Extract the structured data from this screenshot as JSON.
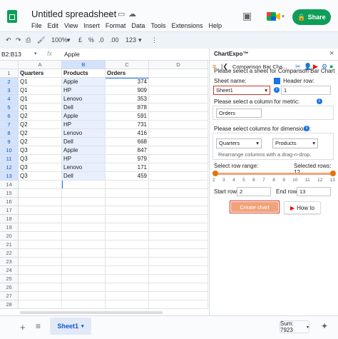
{
  "app": {
    "title": "Untitled spreadsheet",
    "menu": [
      "File",
      "Edit",
      "View",
      "Insert",
      "Format",
      "Data",
      "Tools",
      "Extensions",
      "Help"
    ],
    "share_label": "Share"
  },
  "toolbar": {
    "zoom": "100%",
    "currency": "£",
    "percent": "%",
    "dec_decrease": ".0",
    "dec_increase": ".00",
    "number_format": "123"
  },
  "formula_bar": {
    "name_box": "B2:B13",
    "value": "Apple"
  },
  "grid": {
    "columns": [
      "A",
      "B",
      "C",
      "D"
    ],
    "rows": [
      "1",
      "2",
      "3",
      "4",
      "5",
      "6",
      "7",
      "8",
      "9",
      "10",
      "11",
      "12",
      "13",
      "14",
      "15",
      "16",
      "17",
      "18",
      "19",
      "20",
      "21",
      "22",
      "23",
      "24",
      "25",
      "26",
      "27",
      "28"
    ],
    "headers": [
      "Quarters",
      "Products",
      "Orders"
    ],
    "data": [
      [
        "Q1",
        "Apple",
        "374"
      ],
      [
        "Q1",
        "HP",
        "909"
      ],
      [
        "Q1",
        "Lenovo",
        "353"
      ],
      [
        "Q1",
        "Dell",
        "878"
      ],
      [
        "Q2",
        "Apple",
        "591"
      ],
      [
        "Q2",
        "HP",
        "731"
      ],
      [
        "Q2",
        "Lenovo",
        "416"
      ],
      [
        "Q2",
        "Dell",
        "668"
      ],
      [
        "Q3",
        "Apple",
        "847"
      ],
      [
        "Q3",
        "HP",
        "979"
      ],
      [
        "Q3",
        "Lenovo",
        "171"
      ],
      [
        "Q3",
        "Dell",
        "459"
      ]
    ]
  },
  "sheet_tabs": {
    "active": "Sheet1",
    "sum": "Sum: 7923"
  },
  "panel": {
    "title": "ChartExpo™",
    "plugin_name": "Comparison Bar Cha...",
    "select_sheet_label": "Please select a sheet for Comparison Bar Chart",
    "sheet_name_label": "Sheet name:",
    "header_row_label": "Header row:",
    "sheet_value": "Sheet1",
    "header_row_value": "1",
    "metric_label": "Please select a column for metric:",
    "metric_value": "Orders",
    "dimensions_label": "Please select columns for dimensions:",
    "dimension1": "Quarters",
    "dimension2": "Products",
    "rearrange_hint": "Rearrange columns with a drag-n-drop.",
    "row_range_label": "Select row range:",
    "selected_rows_label": "Selected rows: 12",
    "ticks": [
      "2",
      "3",
      "4",
      "5",
      "6",
      "7",
      "8",
      "9",
      "10",
      "11",
      "12",
      "13"
    ],
    "range_start_fraction": 0.0,
    "range_end_fraction": 1.0,
    "start_row_label": "Start row",
    "start_row_value": "2",
    "end_row_label": "End row",
    "end_row_value": "13",
    "create_label": "Create chart",
    "howto_label": "How to"
  }
}
